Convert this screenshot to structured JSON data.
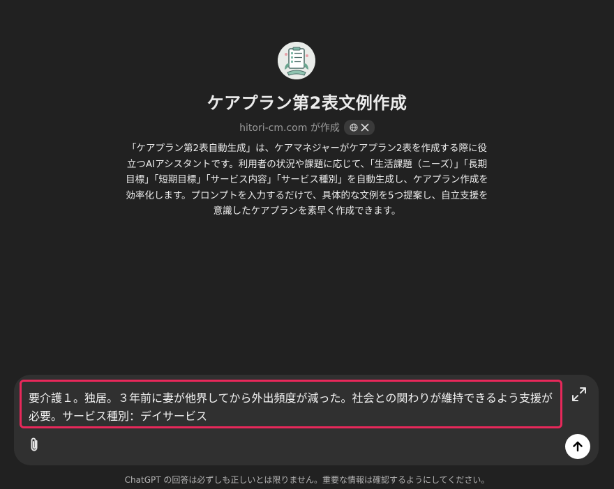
{
  "gpt": {
    "title": "ケアプラン第2表文例作成",
    "author": "hitori-cm.com が作成",
    "avatar_icon": "clipboard-plant-icon",
    "social_icons": [
      "globe-icon",
      "x-logo-icon"
    ],
    "description": "「ケアプラン第2表自動生成」は、ケアマネジャーがケアプラン2表を作成する際に役立つAIアシスタントです。利用者の状況や課題に応じて、「生活課題（ニーズ）」「長期目標」「短期目標」「サービス内容」「サービス種別」を自動生成し、ケアプラン作成を効率化します。プロンプトを入力するだけで、具体的な文例を5つ提案し、自立支援を意識したケアプランを素早く作成できます。"
  },
  "composer": {
    "input_value": "要介護１。独居。３年前に妻が他界してから外出頻度が減った。社会との関わりが維持できるよう支援が必要。サービス種別：デイサービス",
    "highlight_color": "#e8285a",
    "expand_icon": "expand-icon",
    "attach_icon": "paperclip-icon",
    "send_icon": "arrow-up-icon"
  },
  "footer": {
    "disclaimer": "ChatGPT の回答は必ずしも正しいとは限りません。重要な情報は確認するようにしてください。"
  },
  "colors": {
    "background": "#212121",
    "composer_bg": "#303030",
    "text": "#ececec",
    "muted_text": "#9b9b9b"
  }
}
